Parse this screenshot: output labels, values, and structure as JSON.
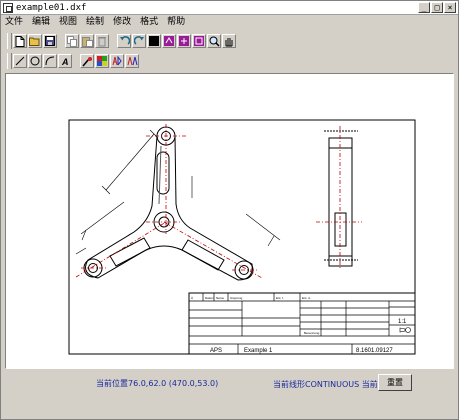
{
  "window": {
    "title": "example01.dxf"
  },
  "menu": [
    "文件",
    "编辑",
    "视图",
    "绘制",
    "修改",
    "格式",
    "帮助"
  ],
  "toolbar1": [
    "new-file-icon",
    "open-folder-icon",
    "save-icon",
    "copy-icon",
    "paste-icon",
    "delete-icon",
    "undo-icon",
    "redo-icon",
    "black-color-icon",
    "layer-a-icon",
    "layer-b-icon",
    "layer-c-icon",
    "zoom-icon",
    "pan-icon"
  ],
  "toolbar2": [
    "line-tool-icon",
    "circle-tool-icon",
    "arc-tool-icon",
    "text-tool-icon",
    "pen-tool-icon",
    "hatch-tool-icon",
    "dimension-tool-icon",
    "mirror-tool-icon"
  ],
  "titleblock": {
    "company": "APS",
    "drawing_title": "Example 1",
    "drawing_number": "8.1601.09127",
    "scale": "1:1",
    "hdr1": "Ä",
    "hdr2": "Datum",
    "hdr3": "Name",
    "hdr4": "Ursprung",
    "hdr5": "Ers. f.",
    "hdr6": "Ers. d.",
    "blockhdr": "Benennung"
  },
  "status": {
    "coords": "当前位置76.0,62.0 (470.0,53.0)",
    "linetype": "当前线形CONTINUOUS 当前层",
    "layer": "重置"
  }
}
